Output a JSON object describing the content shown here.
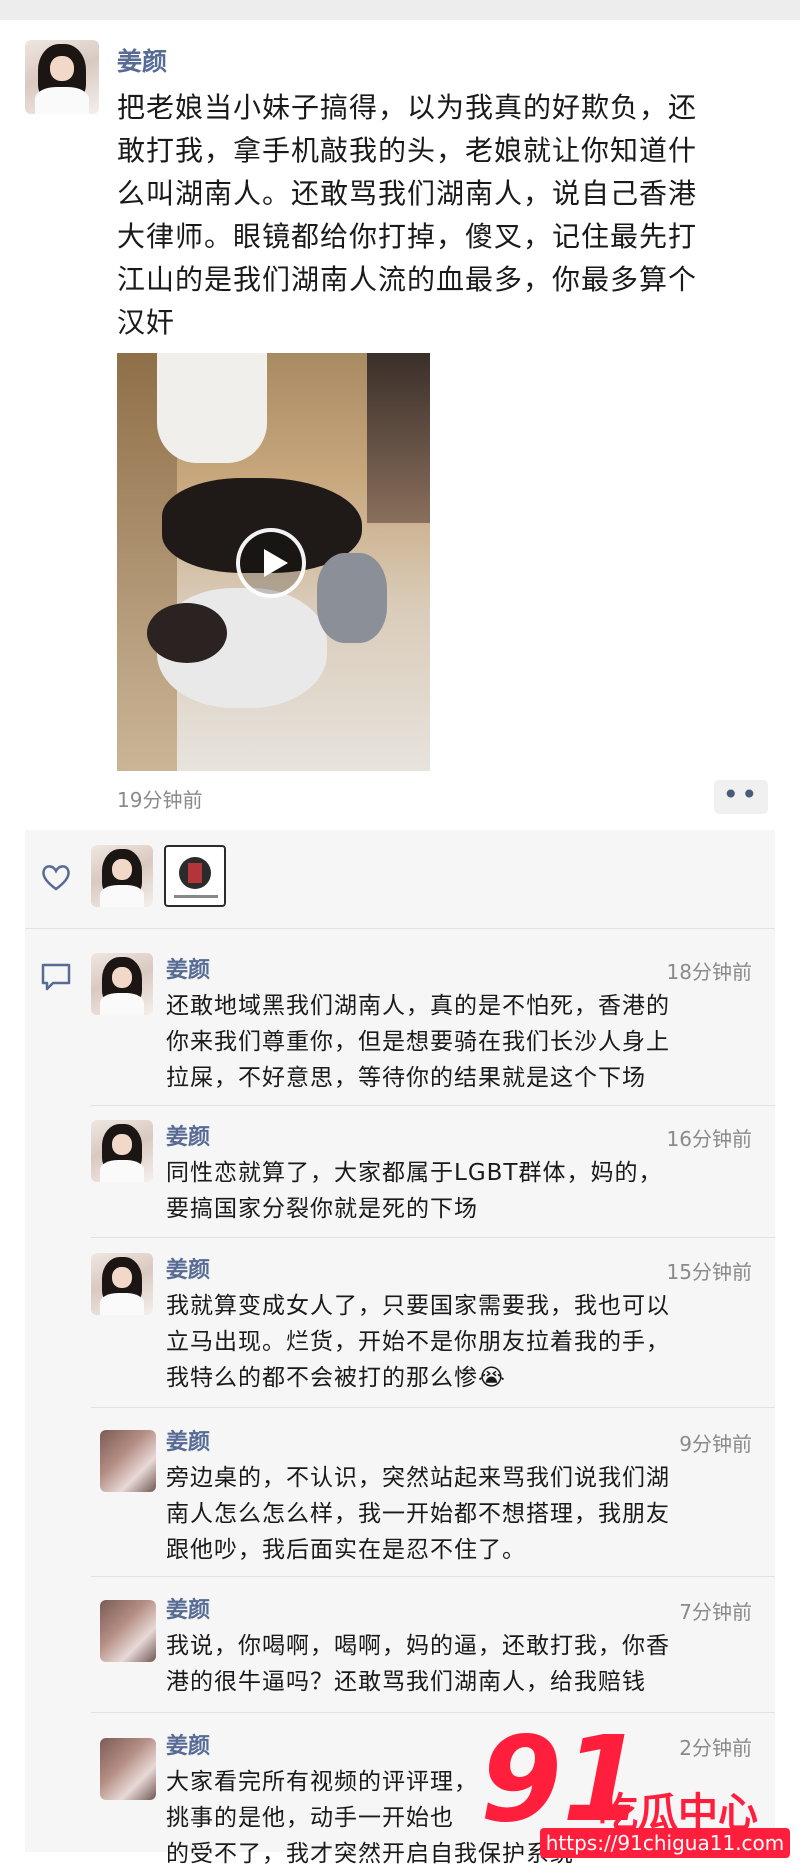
{
  "post": {
    "author": "姜颜",
    "text_lines": [
      "把老娘当小妹子搞得，以为我真的好欺负，还",
      "敢打我，拿手机敲我的头，老娘就让你知道什",
      "么叫湖南人。还敢骂我们湖南人，说自己香港",
      "大律师。眼镜都给你打掉，傻叉，记住最先打",
      "江山的是我们湖南人流的血最多，你最多算个",
      "汉奸"
    ],
    "time": "19分钟前",
    "more_label": "••",
    "media": {
      "type": "video",
      "play_icon": "play-icon"
    }
  },
  "likes": {
    "icon": "heart-icon"
  },
  "comments_icon": "comment-icon",
  "comments": [
    {
      "author": "姜颜",
      "time": "18分钟前",
      "lines": [
        "还敢地域黑我们湖南人，真的是不怕死，香港的",
        "你来我们尊重你，但是想要骑在我们长沙人身上",
        "拉屎，不好意思，等待你的结果就是这个下场"
      ]
    },
    {
      "author": "姜颜",
      "time": "16分钟前",
      "lines": [
        "同性恋就算了，大家都属于LGBT群体，妈的，",
        "要搞国家分裂你就是死的下场"
      ]
    },
    {
      "author": "姜颜",
      "time": "15分钟前",
      "lines": [
        "我就算变成女人了，只要国家需要我，我也可以",
        "立马出现。烂货，开始不是你朋友拉着我的手，",
        "我特么的都不会被打的那么惨😭"
      ]
    },
    {
      "author": "姜颜",
      "time": "9分钟前",
      "lines": [
        "旁边桌的，不认识，突然站起来骂我们说我们湖",
        "南人怎么怎么样，我一开始都不想搭理，我朋友",
        "跟他吵，我后面实在是忍不住了。"
      ]
    },
    {
      "author": "姜颜",
      "time": "7分钟前",
      "lines": [
        "我说，你喝啊，喝啊，妈的逼，还敢打我，你香",
        "港的很牛逼吗？还敢骂我们湖南人，给我赔钱"
      ]
    },
    {
      "author": "姜颜",
      "time": "2分钟前",
      "lines": [
        "大家看完所有视频的评评理，",
        "挑事的是他，动手一开始也",
        "的受不了，我才突然开启自我保护系统"
      ]
    }
  ],
  "watermark": {
    "number": "91",
    "name": "吃瓜中心",
    "url": "https://91chigua11.com"
  }
}
